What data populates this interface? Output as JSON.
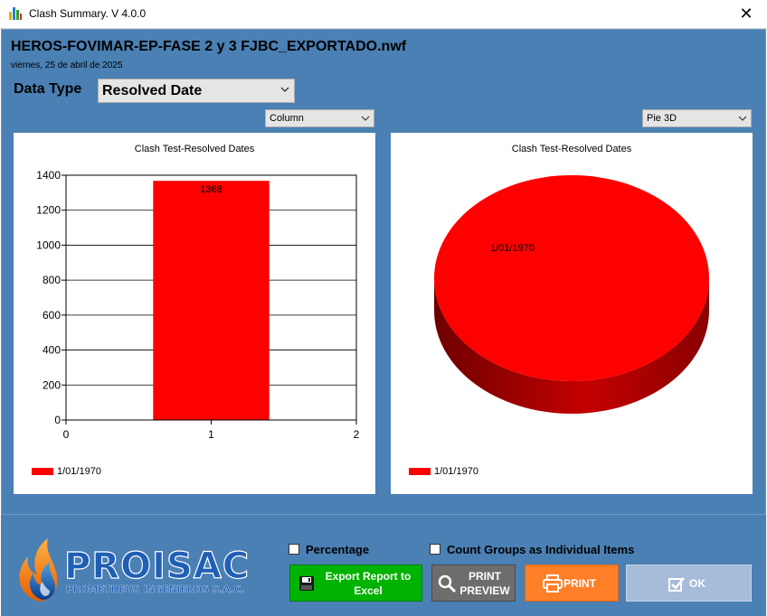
{
  "window": {
    "title": "Clash Summary. V 4.0.0",
    "close_glyph": "✕"
  },
  "report": {
    "title": "HEROS-FOVIMAR-EP-FASE 2 y 3 FJBC_EXPORTADO.nwf",
    "date": "viernes, 25 de abril de 2025"
  },
  "data_type": {
    "label": "Data Type",
    "selected": "Resolved Date"
  },
  "chart_type_left": {
    "selected": "Column"
  },
  "chart_type_right": {
    "selected": "Pie 3D"
  },
  "chart_data": [
    {
      "type": "bar",
      "title": "Clash Test-Resolved Dates",
      "x": [
        1
      ],
      "values": [
        1368
      ],
      "data_labels": [
        "1368"
      ],
      "series": [
        {
          "name": "1/01/1970",
          "values": [
            1368
          ],
          "color": "#ff0000"
        }
      ],
      "xlim": [
        0,
        2
      ],
      "x_ticks": [
        "0",
        "1",
        "2"
      ],
      "ylim": [
        0,
        1400
      ],
      "y_ticks": [
        "0",
        "200",
        "400",
        "600",
        "800",
        "1000",
        "1200",
        "1400"
      ],
      "grid": true,
      "legend_position": "bottom-left"
    },
    {
      "type": "pie",
      "title": "Clash Test-Resolved Dates",
      "categories": [
        "1/01/1970"
      ],
      "values": [
        1368
      ],
      "slice_labels": [
        "1/01/1970"
      ],
      "colors": [
        "#ff0000"
      ],
      "style": "3d",
      "legend_position": "bottom-left"
    }
  ],
  "options": {
    "percentage_label": "Percentage",
    "count_groups_label": "Count Groups as Individual Items"
  },
  "buttons": {
    "export": {
      "line1": "Export Report to",
      "line2": "Excel",
      "icon": "floppy-disk-icon"
    },
    "preview": {
      "line1": "PRINT",
      "line2": "PREVIEW",
      "icon": "magnifier-icon"
    },
    "print": {
      "label": "PRINT",
      "icon": "printer-icon"
    },
    "ok": {
      "label": "OK",
      "icon": "check-box-icon"
    }
  },
  "logo": {
    "name": "PROISAC",
    "tagline": "PROMETHEUS INGENIEROS S.A.C."
  },
  "colors": {
    "window_bg": "#4a80b4",
    "series": "#ff0000",
    "export_button": "#00b300",
    "preview_button": "#6d6d6d",
    "print_button": "#ff7f27",
    "ok_button": "#a6bcd8"
  }
}
